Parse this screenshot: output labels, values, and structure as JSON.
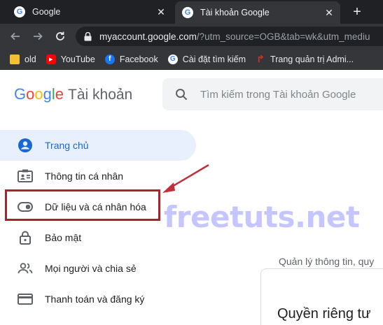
{
  "browser": {
    "tabs": [
      {
        "title": "Google",
        "close": "✕"
      },
      {
        "title": "Tài khoản Google",
        "close": "✕"
      }
    ],
    "new_tab": "+",
    "url_host": "myaccount.google.com",
    "url_rest": "/?utm_source=OGB&tab=wk&utm_mediu",
    "bookmarks": [
      {
        "label": "old",
        "icon": "folder-icon"
      },
      {
        "label": "YouTube",
        "icon": "youtube-icon"
      },
      {
        "label": "Facebook",
        "icon": "facebook-icon"
      },
      {
        "label": "Cài đặt tìm kiếm",
        "icon": "google-icon"
      },
      {
        "label": "Trang quản trị Admi...",
        "icon": "bookmark-red-icon"
      }
    ]
  },
  "header": {
    "logo_letters": [
      "G",
      "o",
      "o",
      "g",
      "l",
      "e"
    ],
    "logo_colors": [
      "#4285f4",
      "#ea4335",
      "#fbbc05",
      "#4285f4",
      "#34a853",
      "#ea4335"
    ],
    "product": "Tài khoản",
    "search_placeholder": "Tìm kiếm trong Tài khoản Google"
  },
  "sidebar": {
    "items": [
      {
        "label": "Trang chủ",
        "icon": "home-account-icon",
        "active": true
      },
      {
        "label": "Thông tin cá nhân",
        "icon": "id-card-icon"
      },
      {
        "label": "Dữ liệu và cá nhân hóa",
        "icon": "toggle-icon"
      },
      {
        "label": "Bảo mật",
        "icon": "lock-icon"
      },
      {
        "label": "Mọi người và chia sẻ",
        "icon": "people-icon"
      },
      {
        "label": "Thanh toán và đăng ký",
        "icon": "credit-card-icon"
      }
    ]
  },
  "watermark": "freetuts.net",
  "main": {
    "subtitle": "Quản lý thông tin, quy",
    "card_title": "Quyền riêng tư"
  },
  "colors": {
    "accent": "#1967d2",
    "highlight": "#a4262c",
    "arrow": "#c0303a"
  }
}
